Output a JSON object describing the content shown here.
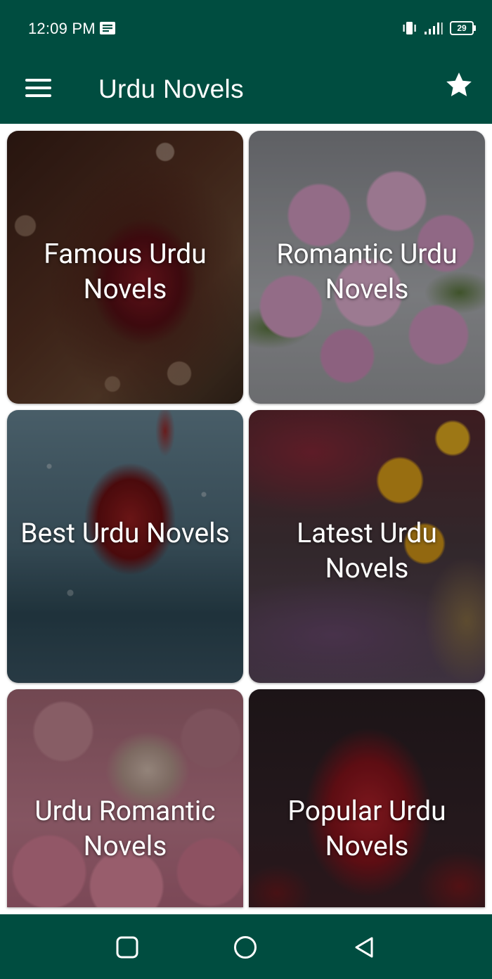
{
  "status_bar": {
    "time": "12:09 PM",
    "battery": "29",
    "icons": [
      "message-icon",
      "vibrate-icon",
      "signal-icon",
      "battery-icon"
    ]
  },
  "app_bar": {
    "title": "Urdu Novels",
    "menu_icon": "menu-icon",
    "favorite_icon": "star-icon"
  },
  "categories": [
    {
      "title": "Famous Urdu Novels",
      "image": "dark red rose with bokeh"
    },
    {
      "title": "Romantic Urdu Novels",
      "image": "bouquet of pink roses"
    },
    {
      "title": "Best Urdu Novels",
      "image": "red rose under water drops"
    },
    {
      "title": "Latest Urdu Novels",
      "image": "sunflowers and lavender"
    },
    {
      "title": "Urdu Romantic Novels",
      "image": "pink roses with heart"
    },
    {
      "title": "Popular Urdu Novels",
      "image": "red rose on dark background"
    }
  ],
  "nav_bar": {
    "buttons": [
      "recents-button",
      "home-button",
      "back-button"
    ]
  },
  "colors": {
    "primary": "#004d40",
    "text_on_primary": "#ffffff"
  }
}
